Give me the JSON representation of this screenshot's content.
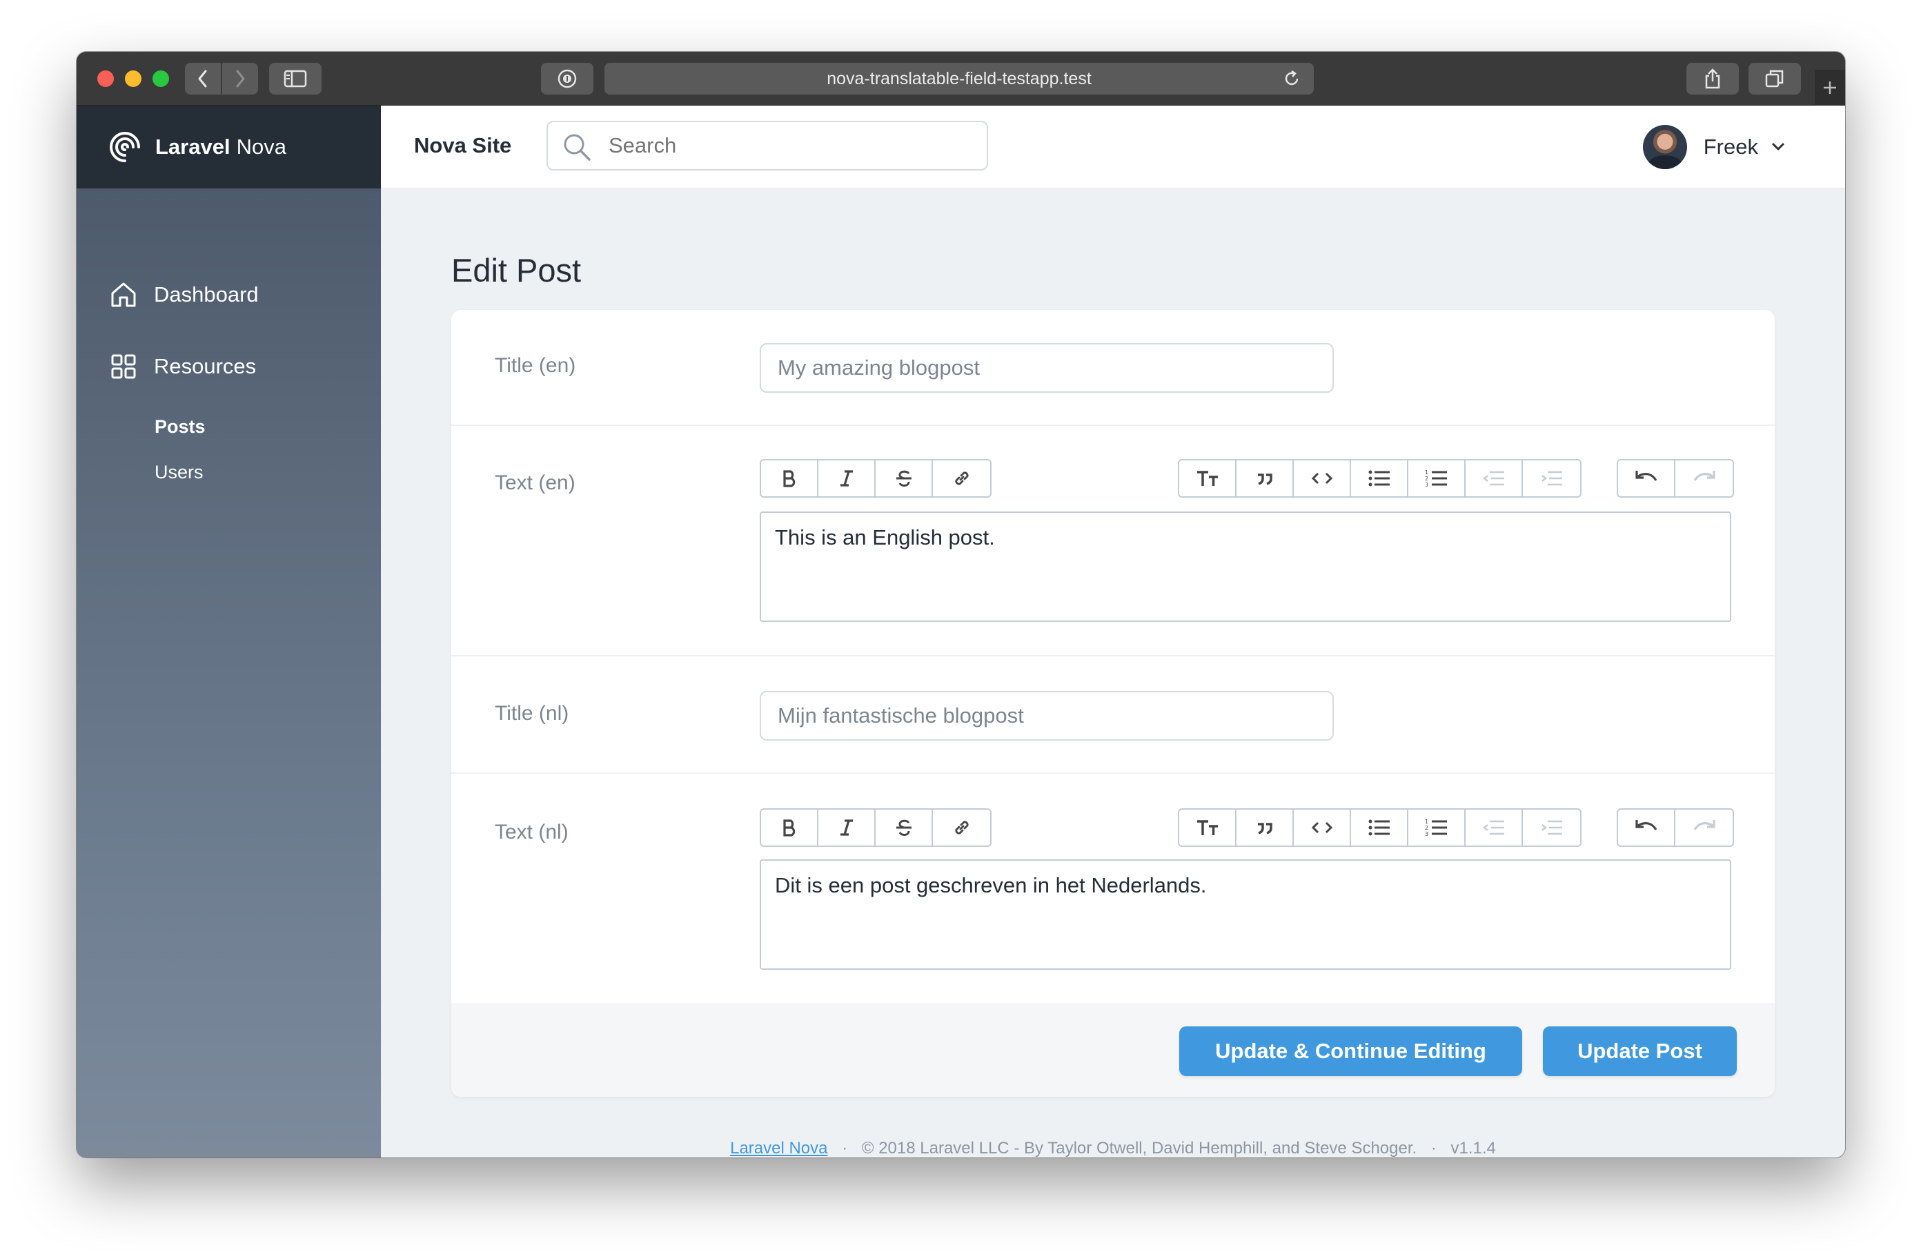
{
  "browser": {
    "url": "nova-translatable-field-testapp.test"
  },
  "sidebar": {
    "brand_strong": "Laravel",
    "brand_light": "Nova",
    "items": [
      {
        "label": "Dashboard",
        "icon": "home-icon"
      },
      {
        "label": "Resources",
        "icon": "grid-icon"
      }
    ],
    "sub_items": [
      {
        "label": "Posts",
        "active": true
      },
      {
        "label": "Users",
        "active": false
      }
    ]
  },
  "header": {
    "site_name": "Nova Site",
    "search_placeholder": "Search",
    "user_name": "Freek"
  },
  "page": {
    "title": "Edit Post"
  },
  "form": {
    "fields": [
      {
        "label": "Title (en)",
        "type": "text",
        "value": "My amazing blogpost"
      },
      {
        "label": "Text (en)",
        "type": "trix",
        "value": "This is an English post."
      },
      {
        "label": "Title (nl)",
        "type": "text",
        "value": "Mijn fantastische blogpost"
      },
      {
        "label": "Text (nl)",
        "type": "trix",
        "value": "Dit is een post geschreven in het Nederlands."
      }
    ],
    "toolbar_buttons": [
      "bold",
      "italic",
      "strike",
      "link",
      "heading",
      "quote",
      "code",
      "bullet-list",
      "number-list",
      "decrease-indent",
      "increase-indent",
      "undo",
      "redo"
    ],
    "update_continue_label": "Update & Continue Editing",
    "update_label": "Update Post"
  },
  "footer": {
    "link": "Laravel Nova",
    "sep1": "·",
    "text": "© 2018 Laravel LLC - By Taylor Otwell, David Hemphill, and Steve Schoger.",
    "sep2": "·",
    "version": "v1.1.4"
  },
  "colors": {
    "accent": "#4099de",
    "sidebar_dark": "#252d37",
    "sidebar_top": "#4a5667",
    "sidebar_bottom": "#7c8a9c",
    "background": "#eef1f4"
  }
}
